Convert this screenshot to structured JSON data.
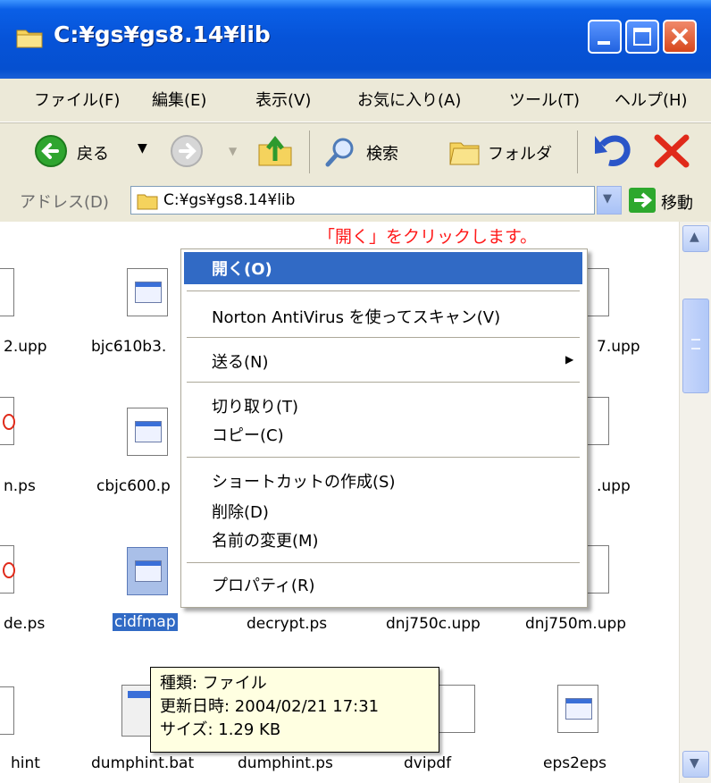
{
  "window": {
    "title": "C:¥gs¥gs8.14¥lib"
  },
  "menu": {
    "items": [
      "ファイル(F)",
      "編集(E)",
      "表示(V)",
      "お気に入り(A)",
      "ツール(T)",
      "ヘルプ(H)"
    ]
  },
  "toolbar": {
    "back_label": "戻る",
    "search_label": "検索",
    "folders_label": "フォルダ"
  },
  "address": {
    "label": "アドレス(D)",
    "value": "C:¥gs¥gs8.14¥lib",
    "go_label": "移動"
  },
  "annotation": {
    "text": "「開く」をクリックします。"
  },
  "files": [
    {
      "name": "2.upp"
    },
    {
      "name": "bjc610b3."
    },
    {
      "name": "7.upp"
    },
    {
      "name": "n.ps"
    },
    {
      "name": "cbjc600.p"
    },
    {
      "name": ".upp"
    },
    {
      "name": "de.ps"
    },
    {
      "name": "cidfmap"
    },
    {
      "name": "decrypt.ps"
    },
    {
      "name": "dnj750c.upp"
    },
    {
      "name": "dnj750m.upp"
    },
    {
      "name": "hint"
    },
    {
      "name": "dumphint.bat"
    },
    {
      "name": "dumphint.ps"
    },
    {
      "name": "dvipdf"
    },
    {
      "name": "eps2eps"
    }
  ],
  "context_menu": {
    "open": "開く(O)",
    "norton": "Norton AntiVirus を使ってスキャン(V)",
    "send_to": "送る(N)",
    "cut": "切り取り(T)",
    "copy": "コピー(C)",
    "shortcut": "ショートカットの作成(S)",
    "delete": "削除(D)",
    "rename": "名前の変更(M)",
    "properties": "プロパティ(R)"
  },
  "tooltip": {
    "type": "種類: ファイル",
    "modified": "更新日時: 2004/02/21 17:31",
    "size": "サイズ: 1.29 KB"
  }
}
